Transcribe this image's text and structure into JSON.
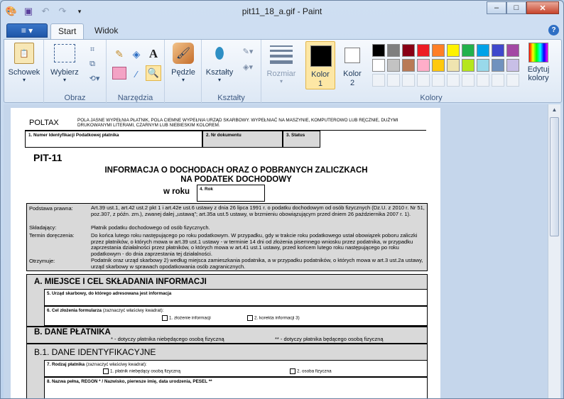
{
  "window": {
    "title": "pit11_18_a.gif - Paint",
    "controls": {
      "minimize": "–",
      "maximize": "□",
      "close": "✕"
    }
  },
  "tabs": {
    "file": "≡ ▾",
    "home": "Start",
    "view": "Widok",
    "help": "?"
  },
  "ribbon": {
    "clipboard": {
      "label": "Schowek"
    },
    "image": {
      "select": "Wybierz",
      "group": "Obraz"
    },
    "tools": {
      "group": "Narzędzia"
    },
    "brushes": {
      "label": "Pędzle"
    },
    "shapes": {
      "label": "Kształty",
      "group": "Kształty"
    },
    "size": {
      "label": "Rozmiar"
    },
    "color1": {
      "label": "Kolor",
      "num": "1",
      "hex": "#000000"
    },
    "color2": {
      "label": "Kolor",
      "num": "2",
      "hex": "#ffffff"
    },
    "colors": {
      "group": "Kolory"
    },
    "edit_colors": {
      "label1": "Edytuj",
      "label2": "kolory"
    },
    "palette": [
      "#000000",
      "#7f7f7f",
      "#880015",
      "#ed1c24",
      "#ff7f27",
      "#fff200",
      "#22b14c",
      "#00a2e8",
      "#3f48cc",
      "#a349a4",
      "#ffffff",
      "#c3c3c3",
      "#b97a57",
      "#ffaec9",
      "#ffc90e",
      "#efe4b0",
      "#b5e61d",
      "#99d9ea",
      "#7092be",
      "#c8bfe7"
    ]
  },
  "doc": {
    "poltax": "POLTAX",
    "instruction": "POLA JASNE WYPEŁNIA PŁATNIK, POLA CIEMNE WYPEŁNIA URZĄD SKARBOWY. WYPEŁNIAĆ NA MASZYNIE, KOMPUTEROWO LUB RĘCZNIE, DUŻYMI DRUKOWANYMI LITERAMI, CZARNYM LUB NIEBIESKIM KOLOREM.",
    "f1": "1. Numer Identyfikacji Podatkowej płatnika",
    "f2": "2. Nr dokumentu",
    "f3": "3. Status",
    "formcode": "PIT-11",
    "heading1": "INFORMACJA O DOCHODACH ORAZ O POBRANYCH ZALICZKACH",
    "heading2": "NA PODATEK DOCHODOWY",
    "year_label": "w roku",
    "f4": "4. Rok",
    "basis_label": "Podstawa prawna:",
    "basis_text": "Art.39 ust.1, art.42 ust.2 pkt 1 i art.42e ust.6 ustawy z dnia 26 lipca 1991 r. o podatku dochodowym od osób fizycznych (Dz.U. z 2010 r. Nr 51, poz.307, z późn. zm.), zwanej dalej „ustawą”; art.35a ust.5 ustawy, w brzmieniu obowiązującym przed dniem 26 października 2007 r. 1).",
    "filer_label": "Składający:",
    "filer_text": "Płatnik podatku dochodowego od osób fizycznych.",
    "deadline_label": "Termin doręczenia:",
    "deadline_text": "Do końca lutego roku następującego po roku podatkowym. W przypadku, gdy w trakcie roku podatkowego ustał obowiązek poboru zaliczki przez płatników, o których mowa w art.39 ust.1 ustawy - w terminie 14 dni od złożenia pisemnego wniosku przez podatnika, w przypadku zaprzestania działalności przez płatników, o których mowa w art.41 ust.1 ustawy, przed końcem lutego roku następującego po roku podatkowym - do dnia zaprzestania tej działalności.",
    "recipient_label": "Otrzymuje:",
    "recipient_text": "Podatnik oraz urząd skarbowy 2) według miejsca zamieszkania podatnika, a w przypadku podatników, o których mowa w art.3 ust.2a ustawy, urząd skarbowy w sprawach opodatkowania osób zagranicznych.",
    "secA": "A. MIEJSCE I CEL SKŁADANIA INFORMACJI",
    "f5": "5. Urząd skarbowy, do którego adresowana jest informacja",
    "f6": "6. Cel złożenia formularza",
    "f6_hint": "(zaznaczyć właściwy kwadrat):",
    "opt1": "1. złożenie informacji",
    "opt2": "2. korekta informacji 3)",
    "secB": "B. DANE PŁATNIKA",
    "note1": "* - dotyczy płatnika niebędącego osobą fizyczną",
    "note2": "** - dotyczy płatnika będącego osobą fizyczną",
    "secB1": "B.1. DANE IDENTYFIKACYJNE",
    "f7": "7. Rodzaj płatnika",
    "f7_hint": "(zaznaczyć właściwy kwadrat):",
    "f7_opt1": "1. płatnik niebędący osobą fizyczną",
    "f7_opt2": "2. osoba fizyczna",
    "f8": "8. Nazwa pełna, REGON * / Nazwisko, pierwsze imię, data urodzenia, PESEL **"
  }
}
